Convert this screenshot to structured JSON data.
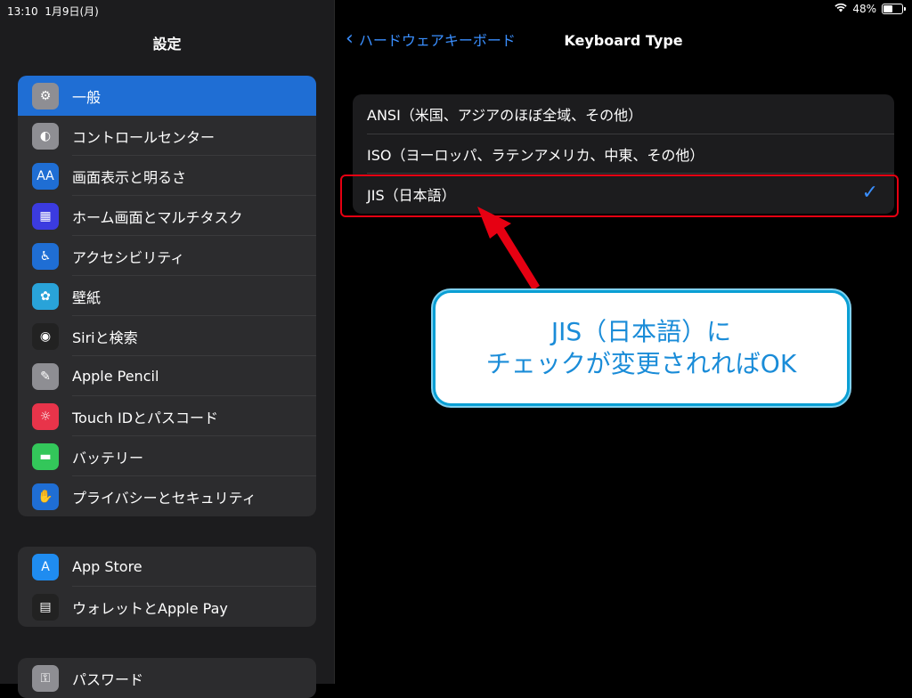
{
  "status": {
    "time": "13:10",
    "date": "1月9日(月)",
    "battery": "48%",
    "battery_level": 0.48
  },
  "sidebar": {
    "title": "設定",
    "group1": [
      {
        "label": "一般",
        "icon": "gear-icon",
        "color": "#8e8e93",
        "glyph": "⚙",
        "selected": true
      },
      {
        "label": "コントロールセンター",
        "icon": "toggle-icon",
        "color": "#8e8e93",
        "glyph": "◐"
      },
      {
        "label": "画面表示と明るさ",
        "icon": "text-size-icon",
        "color": "#1f6ed4",
        "glyph": "AA"
      },
      {
        "label": "ホーム画面とマルチタスク",
        "icon": "home-grid-icon",
        "color": "#3b3be0",
        "glyph": "▦"
      },
      {
        "label": "アクセシビリティ",
        "icon": "accessibility-icon",
        "color": "#1f6ed4",
        "glyph": "♿"
      },
      {
        "label": "壁紙",
        "icon": "wallpaper-flower-icon",
        "color": "#29a3d9",
        "glyph": "✿"
      },
      {
        "label": "Siriと検索",
        "icon": "siri-icon",
        "color": "#222222",
        "glyph": "◉"
      },
      {
        "label": "Apple Pencil",
        "icon": "pencil-icon",
        "color": "#8e8e93",
        "glyph": "✎"
      },
      {
        "label": "Touch IDとパスコード",
        "icon": "fingerprint-icon",
        "color": "#e8344a",
        "glyph": "☼"
      },
      {
        "label": "バッテリー",
        "icon": "battery-icon",
        "color": "#33c75a",
        "glyph": "▬"
      },
      {
        "label": "プライバシーとセキュリティ",
        "icon": "hand-icon",
        "color": "#1f6ed4",
        "glyph": "✋"
      }
    ],
    "group2": [
      {
        "label": "App Store",
        "icon": "app-store-icon",
        "color": "#1f8cf0",
        "glyph": "A"
      },
      {
        "label": "ウォレットとApple Pay",
        "icon": "wallet-icon",
        "color": "#222222",
        "glyph": "▤"
      }
    ],
    "group3": [
      {
        "label": "パスワード",
        "icon": "key-icon",
        "color": "#8e8e93",
        "glyph": "⚿"
      }
    ]
  },
  "nav": {
    "back_label": "ハードウェアキーボード",
    "title": "Keyboard Type"
  },
  "options": [
    {
      "label": "ANSI（米国、アジアのほぼ全域、その他）",
      "checked": false
    },
    {
      "label": "ISO（ヨーロッパ、ラテンアメリカ、中東、その他）",
      "checked": false
    },
    {
      "label": "JIS（日本語）",
      "checked": true
    }
  ],
  "callout": {
    "line1": "JIS（日本語）に",
    "line2": "チェックが変更されればOK"
  },
  "colors": {
    "accent": "#3a8fff",
    "highlight_red": "#e60012",
    "callout_blue": "#1a8cd8"
  }
}
